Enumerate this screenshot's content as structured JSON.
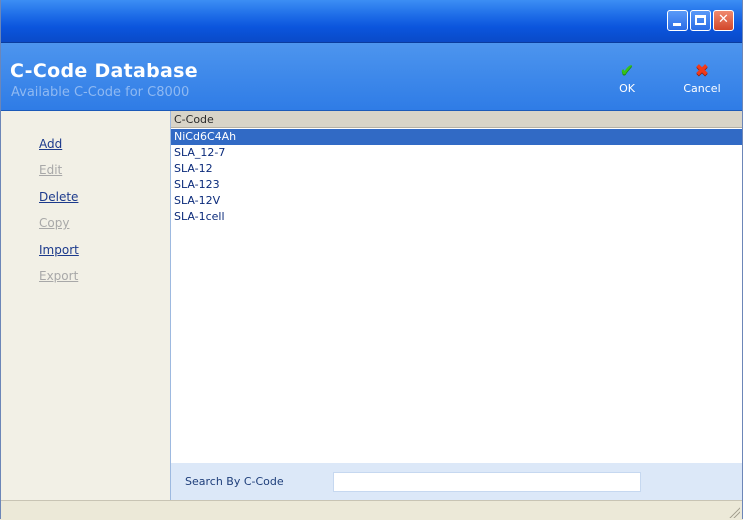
{
  "window": {
    "controls": {
      "minimize_icon": "minimize-icon",
      "maximize_icon": "maximize-icon",
      "close_icon": "close-icon",
      "close_glyph": "✕"
    }
  },
  "header": {
    "title": "C-Code Database",
    "subtitle": "Available C-Code for C8000",
    "ok": {
      "label": "OK",
      "icon": "checkmark-icon",
      "glyph": "✔",
      "color": "#35c21a"
    },
    "cancel": {
      "label": "Cancel",
      "icon": "red-x-icon",
      "glyph": "✖",
      "color": "#f03a1a"
    }
  },
  "sidebar": {
    "items": [
      {
        "label": "Add",
        "enabled": true
      },
      {
        "label": "Edit",
        "enabled": false
      },
      {
        "label": "Delete",
        "enabled": true
      },
      {
        "label": "Copy",
        "enabled": false
      },
      {
        "label": "Import",
        "enabled": true
      },
      {
        "label": "Export",
        "enabled": false
      }
    ]
  },
  "list": {
    "column_header": "C-Code",
    "rows": [
      "NiCd6C4Ah",
      "SLA_12-7",
      "SLA-12",
      "SLA-123",
      "SLA-12V",
      "SLA-1cell"
    ],
    "selected_index": 0
  },
  "search": {
    "label": "Search By C-Code",
    "value": ""
  },
  "colors": {
    "titlebar": "#0b55dd",
    "header": "#2f7ce6",
    "selection": "#316ac5",
    "link": "#1c3a8c",
    "disabled": "#a8a8a8"
  }
}
